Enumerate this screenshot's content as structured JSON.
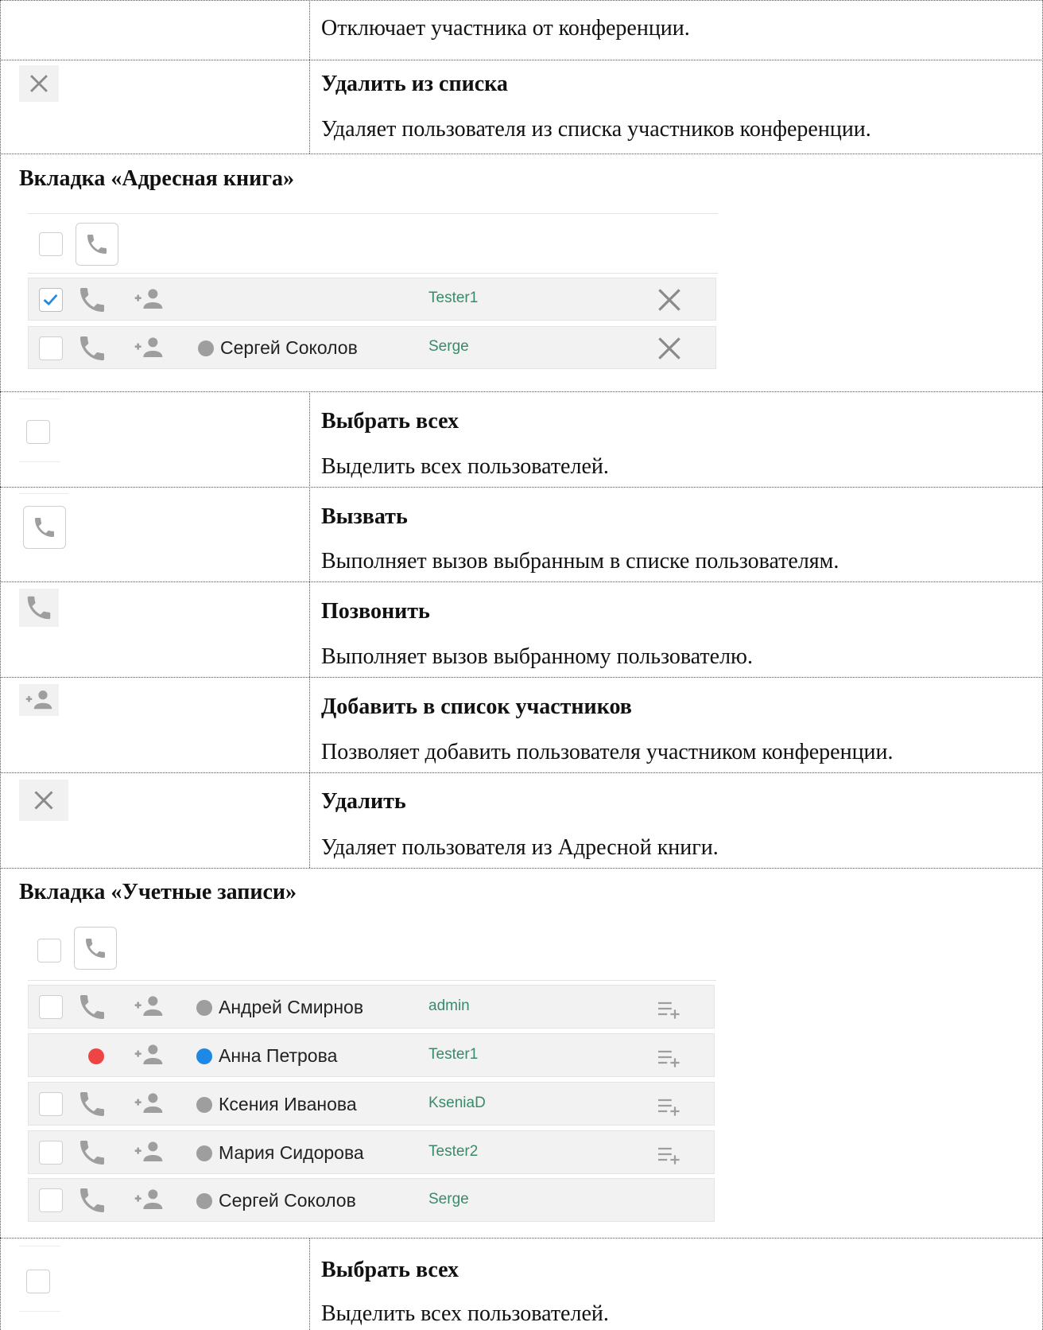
{
  "rows": [
    {
      "desc": "Отключает участника от конференции."
    },
    {
      "title": "Удалить из списка",
      "desc": "Удаляет пользователя из списка участников конференции."
    }
  ],
  "address_book": {
    "heading": "Вкладка «Адресная книга»",
    "entries": [
      {
        "checked": true,
        "name": "",
        "login": "Tester1",
        "status_color": "#9e9e9e"
      },
      {
        "checked": false,
        "name": "Сергей Соколов",
        "login": "Serge",
        "status_color": "#9e9e9e"
      }
    ],
    "rows": [
      {
        "title": "Выбрать всех",
        "desc": "Выделить всех пользователей."
      },
      {
        "title": "Вызвать",
        "desc": "Выполняет вызов выбранным в списке пользователям."
      },
      {
        "title": "Позвонить",
        "desc": "Выполняет вызов выбранному пользователю."
      },
      {
        "title": "Добавить в список участников",
        "desc": "Позволяет добавить пользователя участником конференции."
      },
      {
        "title": "Удалить",
        "desc": "Удаляет пользователя из Адресной книги."
      }
    ]
  },
  "accounts": {
    "heading": "Вкладка «Учетные записи»",
    "entries": [
      {
        "name": "Андрей Смирнов",
        "login": "admin",
        "status_color": "#9e9e9e",
        "has_checkbox": true,
        "has_call": true,
        "has_list_add": true,
        "call_state_color": ""
      },
      {
        "name": "Анна Петрова",
        "login": "Tester1",
        "status_color": "#1e88e5",
        "has_checkbox": false,
        "has_call": false,
        "has_list_add": true,
        "call_state_color": "#ef4444"
      },
      {
        "name": "Ксения Иванова",
        "login": "KseniaD",
        "status_color": "#9e9e9e",
        "has_checkbox": true,
        "has_call": true,
        "has_list_add": true,
        "call_state_color": ""
      },
      {
        "name": "Мария Сидорова",
        "login": "Tester2",
        "status_color": "#9e9e9e",
        "has_checkbox": true,
        "has_call": true,
        "has_list_add": true,
        "call_state_color": ""
      },
      {
        "name": "Сергей Соколов",
        "login": "Serge",
        "status_color": "#9e9e9e",
        "has_checkbox": true,
        "has_call": true,
        "has_list_add": false,
        "call_state_color": ""
      }
    ],
    "rows": [
      {
        "title": "Выбрать всех",
        "desc": "Выделить всех пользователей."
      }
    ]
  },
  "icons": {
    "close": "close-icon",
    "phone": "phone-icon",
    "add_person": "add-person-icon",
    "checkbox": "checkbox-icon",
    "list_add": "playlist-add-icon"
  },
  "colors": {
    "icon_gray": "#9e9e9e",
    "check_blue": "#1e88e5",
    "login_green": "#3a8a6a"
  }
}
